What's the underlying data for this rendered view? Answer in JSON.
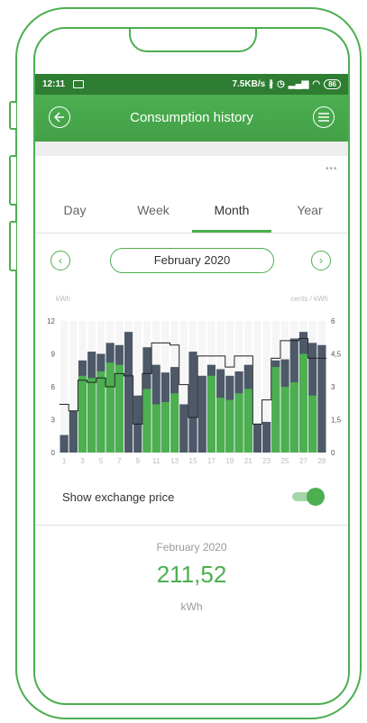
{
  "status": {
    "time": "12:11",
    "speed": "7.5KB/s",
    "battery": "86"
  },
  "appbar": {
    "title": "Consumption history",
    "back_icon": "back-arrow-icon",
    "menu_icon": "hamburger-menu-icon"
  },
  "more_label": "•••",
  "tabs": [
    {
      "label": "Day"
    },
    {
      "label": "Week"
    },
    {
      "label": "Month",
      "active": true
    },
    {
      "label": "Year"
    }
  ],
  "period": {
    "label": "February 2020"
  },
  "axis_units": {
    "left": "kWh",
    "right": "cents / kWh"
  },
  "chart_data": {
    "type": "bar",
    "x_ticks": [
      "1",
      "3",
      "5",
      "7",
      "9",
      "11",
      "13",
      "15",
      "17",
      "19",
      "21",
      "23",
      "25",
      "27",
      "29"
    ],
    "y_left": {
      "ticks": [
        "0",
        "3",
        "6",
        "9",
        "12"
      ],
      "range": [
        0,
        12
      ]
    },
    "y_right": {
      "ticks": [
        "0",
        "1,5",
        "3",
        "4,5",
        "6"
      ],
      "range": [
        0,
        6
      ]
    },
    "days": [
      1,
      2,
      3,
      4,
      5,
      6,
      7,
      8,
      9,
      10,
      11,
      12,
      13,
      14,
      15,
      16,
      17,
      18,
      19,
      20,
      21,
      22,
      23,
      24,
      25,
      26,
      27,
      28,
      29
    ],
    "total_kwh": [
      1.6,
      3.8,
      8.4,
      9.2,
      9.0,
      10.0,
      9.8,
      11.0,
      5.2,
      9.6,
      8.0,
      7.3,
      7.8,
      4.4,
      9.2,
      7.0,
      8.0,
      7.6,
      7.0,
      7.4,
      8.0,
      2.6,
      2.8,
      8.4,
      8.5,
      10.4,
      11.0,
      10.0,
      9.8
    ],
    "green_kwh": [
      0,
      0,
      7.0,
      6.8,
      7.4,
      8.2,
      8.0,
      0,
      0,
      5.8,
      4.4,
      4.6,
      5.4,
      0,
      0,
      0,
      7.0,
      5.0,
      4.8,
      5.4,
      5.8,
      0,
      0,
      7.8,
      6.0,
      6.4,
      9.0,
      5.2,
      0
    ],
    "price_cents_kwh": [
      2.2,
      1.9,
      3.3,
      3.2,
      3.4,
      3.0,
      3.6,
      3.5,
      1.3,
      3.6,
      5.0,
      5.0,
      4.9,
      3.1,
      1.6,
      4.4,
      4.4,
      4.4,
      3.9,
      4.4,
      4.4,
      1.3,
      2.4,
      4.3,
      5.1,
      5.1,
      5.2,
      4.3,
      4.3
    ],
    "colors": {
      "total": "#4d5968",
      "green": "#4caf50",
      "price_line": "#222222",
      "weekend_band": "#eeeeee"
    }
  },
  "toggle": {
    "label": "Show exchange price",
    "on": true
  },
  "summary": {
    "period": "February 2020",
    "value": "211,52",
    "unit": "kWh"
  }
}
